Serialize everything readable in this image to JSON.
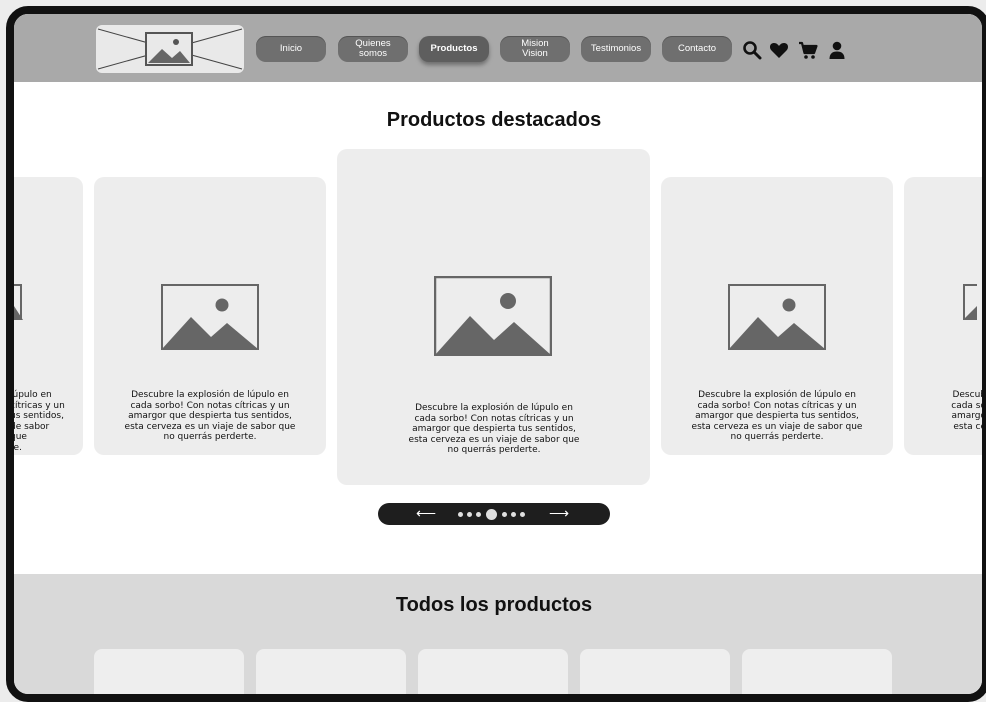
{
  "nav": {
    "items": [
      {
        "label_line1": "Inicio",
        "label_line2": ""
      },
      {
        "label_line1": "Quienes",
        "label_line2": "somos"
      },
      {
        "label_line1": "Productos",
        "label_line2": ""
      },
      {
        "label_line1": "Mision",
        "label_line2": "Vision"
      },
      {
        "label_line1": "Testimonios",
        "label_line2": ""
      },
      {
        "label_line1": "Contacto",
        "label_line2": ""
      }
    ],
    "active": "Productos",
    "icons": [
      "search-icon",
      "heart-icon",
      "cart-icon",
      "user-icon"
    ]
  },
  "featured": {
    "title": "Productos destacados",
    "card_text": "Descubre la explosión de lúpulo en cada sorbo! Con notas cítricas y un amargor que despierta tus sentidos, esta cerveza es un viaje de sabor que no querrás perderte.",
    "partial_left_text": "lúpulo en\ncítricas y un\nus sentidos,\nde sabor que\nte.",
    "partial_right_text": "Descub\ncada so\namargo\nesta ce"
  },
  "carousel": {
    "prev_symbol": "⟵",
    "next_symbol": "⟶",
    "dot_count": 7,
    "active_dot_index": 3
  },
  "all_products": {
    "title": "Todos los productos"
  },
  "colors": {
    "header_bg": "#a9a9a9",
    "nav_button": "#6f6f6f",
    "card_bg": "#ededed",
    "section_bg": "#d9d9d9",
    "image_placeholder": "#666666"
  }
}
